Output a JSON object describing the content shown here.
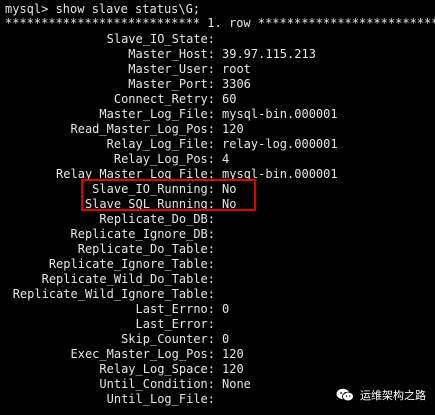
{
  "terminal": {
    "prompt": "mysql> show slave status\\G;",
    "row_header": "*************************** 1. row ***************************",
    "fields": [
      {
        "key": "Slave_IO_State:",
        "value": ""
      },
      {
        "key": "Master_Host:",
        "value": "39.97.115.213"
      },
      {
        "key": "Master_User:",
        "value": "root"
      },
      {
        "key": "Master_Port:",
        "value": "3306"
      },
      {
        "key": "Connect_Retry:",
        "value": "60"
      },
      {
        "key": "Master_Log_File:",
        "value": "mysql-bin.000001"
      },
      {
        "key": "Read_Master_Log_Pos:",
        "value": "120"
      },
      {
        "key": "Relay_Log_File:",
        "value": "relay-log.000001"
      },
      {
        "key": "Relay_Log_Pos:",
        "value": "4"
      },
      {
        "key": "Relay_Master_Log_File:",
        "value": "mysql-bin.000001"
      },
      {
        "key": "Slave_IO_Running:",
        "value": "No"
      },
      {
        "key": "Slave_SQL_Running:",
        "value": "No"
      },
      {
        "key": "Replicate_Do_DB:",
        "value": ""
      },
      {
        "key": "Replicate_Ignore_DB:",
        "value": ""
      },
      {
        "key": "Replicate_Do_Table:",
        "value": ""
      },
      {
        "key": "Replicate_Ignore_Table:",
        "value": ""
      },
      {
        "key": "Replicate_Wild_Do_Table:",
        "value": ""
      },
      {
        "key": "Replicate_Wild_Ignore_Table:",
        "value": ""
      },
      {
        "key": "Last_Errno:",
        "value": "0"
      },
      {
        "key": "Last_Error:",
        "value": ""
      },
      {
        "key": "Skip_Counter:",
        "value": "0"
      },
      {
        "key": "Exec_Master_Log_Pos:",
        "value": "120"
      },
      {
        "key": "Relay_Log_Space:",
        "value": "120"
      },
      {
        "key": "Until_Condition:",
        "value": "None"
      },
      {
        "key": "Until_Log_File:",
        "value": ""
      }
    ]
  },
  "highlight_color": "#e00000",
  "watermark": {
    "text": "运维架构之路",
    "icon": "wechat-channel-icon"
  }
}
